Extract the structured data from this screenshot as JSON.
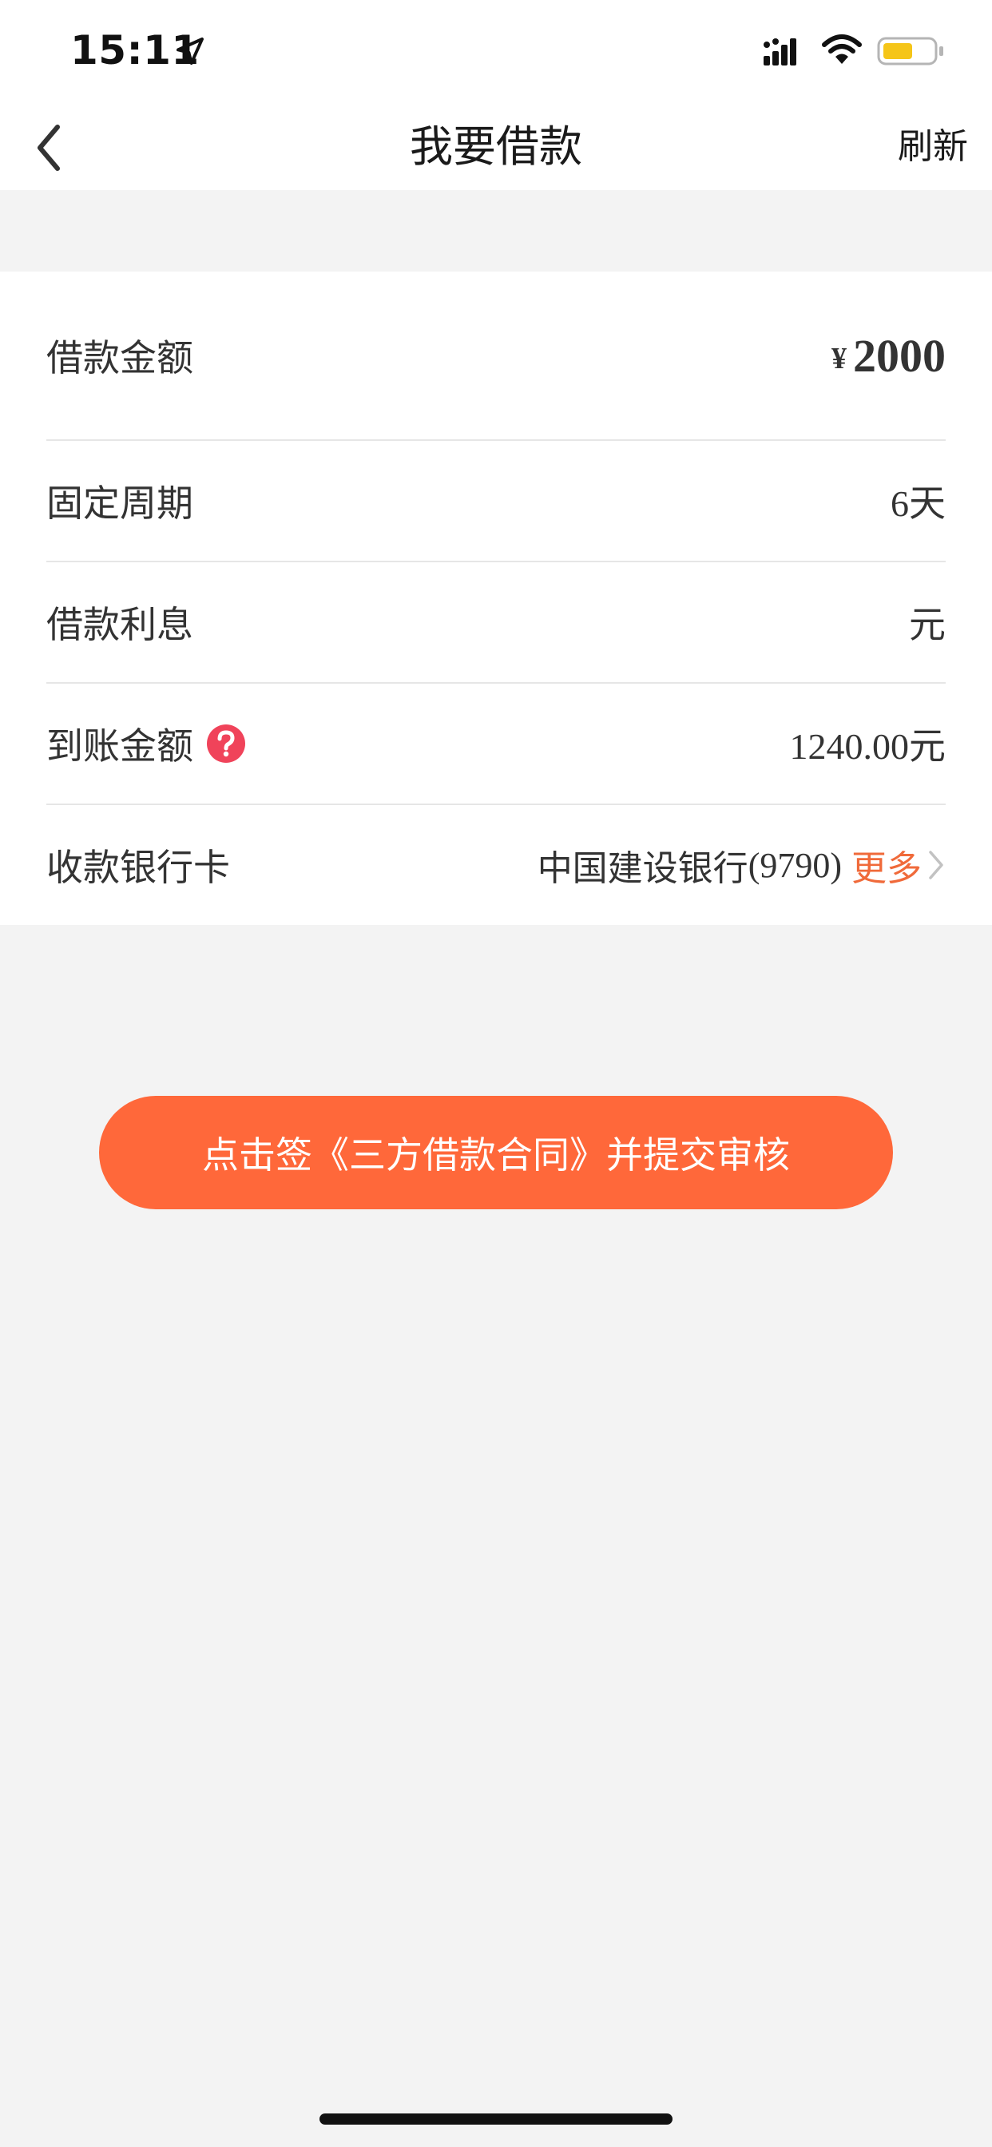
{
  "status_bar": {
    "time": "15:11",
    "location_icon": "location-arrow-icon",
    "signal_icon": "cellular-signal-icon",
    "wifi_icon": "wifi-icon",
    "battery_icon": "battery-icon",
    "battery_color": "#f5c518"
  },
  "nav": {
    "back_icon": "chevron-left-icon",
    "title": "我要借款",
    "refresh_label": "刷新"
  },
  "form": {
    "amount": {
      "label": "借款金额",
      "currency": "¥",
      "value": "2000"
    },
    "period": {
      "label": "固定周期",
      "value": "6天"
    },
    "interest": {
      "label": "借款利息",
      "value": "元"
    },
    "received": {
      "label": "到账金额",
      "help_icon": "question-circle-icon",
      "value": "1240.00元"
    },
    "bank": {
      "label": "收款银行卡",
      "bank_name": "中国建设银行",
      "card_suffix": "(9790)",
      "more_label": "更多",
      "chevron_icon": "chevron-right-icon"
    }
  },
  "submit": {
    "label": "点击签《三方借款合同》并提交审核"
  },
  "colors": {
    "accent": "#ff683a",
    "link": "#f06a3a",
    "help_icon": "#f0435a",
    "background": "#f3f3f3"
  }
}
